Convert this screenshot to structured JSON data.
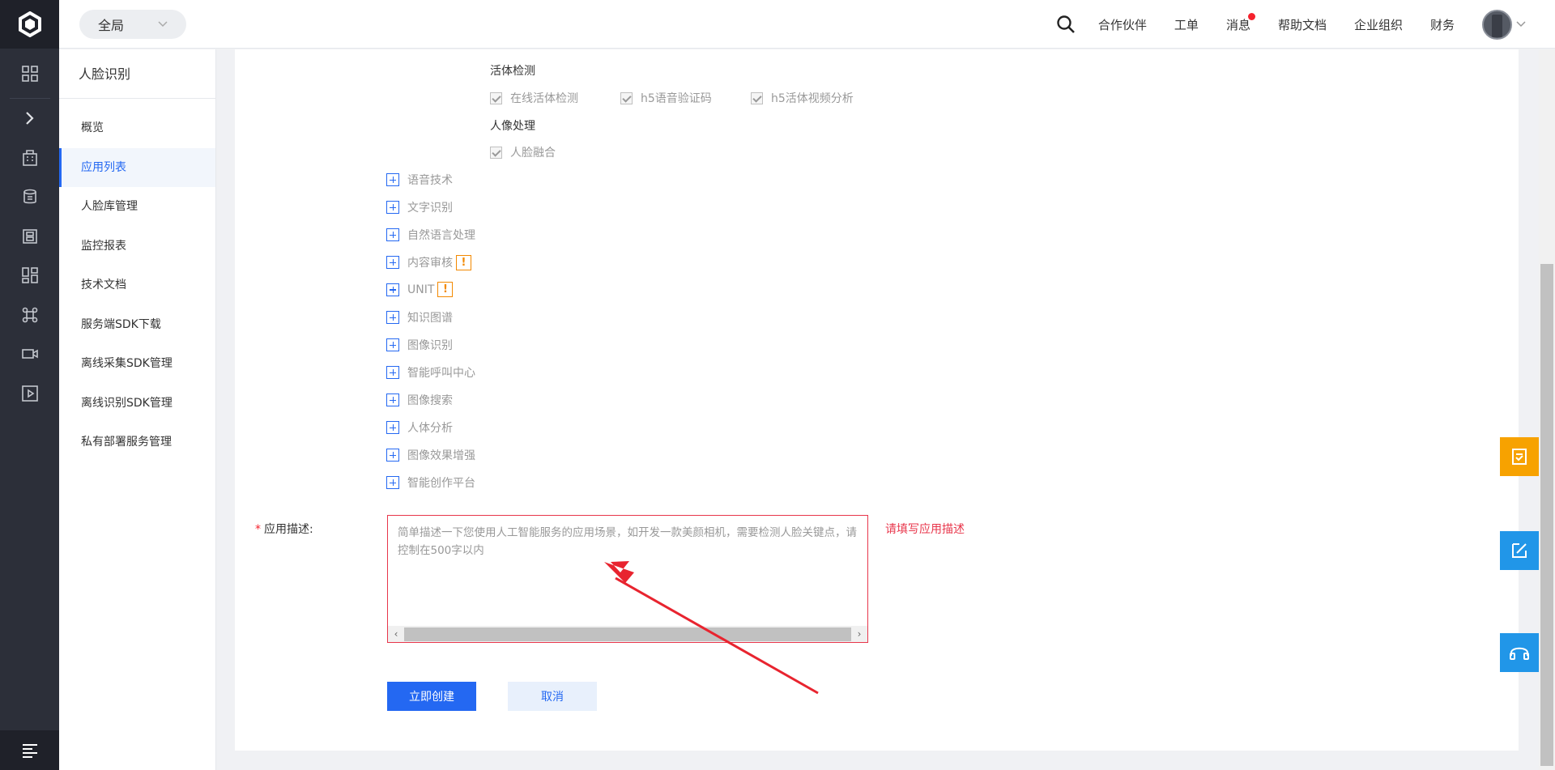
{
  "topbar": {
    "scope_label": "全局",
    "links": [
      "合作伙伴",
      "工单",
      "消息",
      "帮助文档",
      "企业组织",
      "财务"
    ]
  },
  "rail": {
    "icons": [
      "apps-icon",
      "expand-icon",
      "building-icon",
      "database-icon",
      "server-icon",
      "dashboard-icon",
      "command-icon",
      "video-icon",
      "play-icon"
    ]
  },
  "subnav": {
    "title": "人脸识别",
    "items": [
      "概览",
      "应用列表",
      "人脸库管理",
      "监控报表",
      "技术文档",
      "服务端SDK下载",
      "离线采集SDK管理",
      "离线识别SDK管理",
      "私有部署服务管理"
    ],
    "active_index": 1
  },
  "form": {
    "liveness_group": "活体检测",
    "liveness_options": [
      "在线活体检测",
      "h5语音验证码",
      "h5活体视频分析"
    ],
    "portrait_group": "人像处理",
    "portrait_options": [
      "人脸融合"
    ],
    "expandable": [
      "语音技术",
      "文字识别",
      "自然语言处理",
      "内容审核",
      "UNIT",
      "知识图谱",
      "图像识别",
      "智能呼叫中心",
      "图像搜索",
      "人体分析",
      "图像效果增强",
      "智能创作平台"
    ],
    "warn_mark": "!",
    "desc_required_mark": "*",
    "desc_label": "应用描述:",
    "desc_placeholder": "简单描述一下您使用人工智能服务的应用场景，如开发一款美颜相机，需要检测人脸关键点，请控制在500字以内",
    "desc_value": "",
    "desc_error": "请填写应用描述",
    "create_label": "立即创建",
    "cancel_label": "取消"
  },
  "colors": {
    "accent": "#2468f2",
    "error": "#e8364b",
    "warning": "#f38900",
    "float_orange": "#f7a200",
    "float_blue": "#2196e8",
    "rail_bg": "#2c2f39"
  }
}
